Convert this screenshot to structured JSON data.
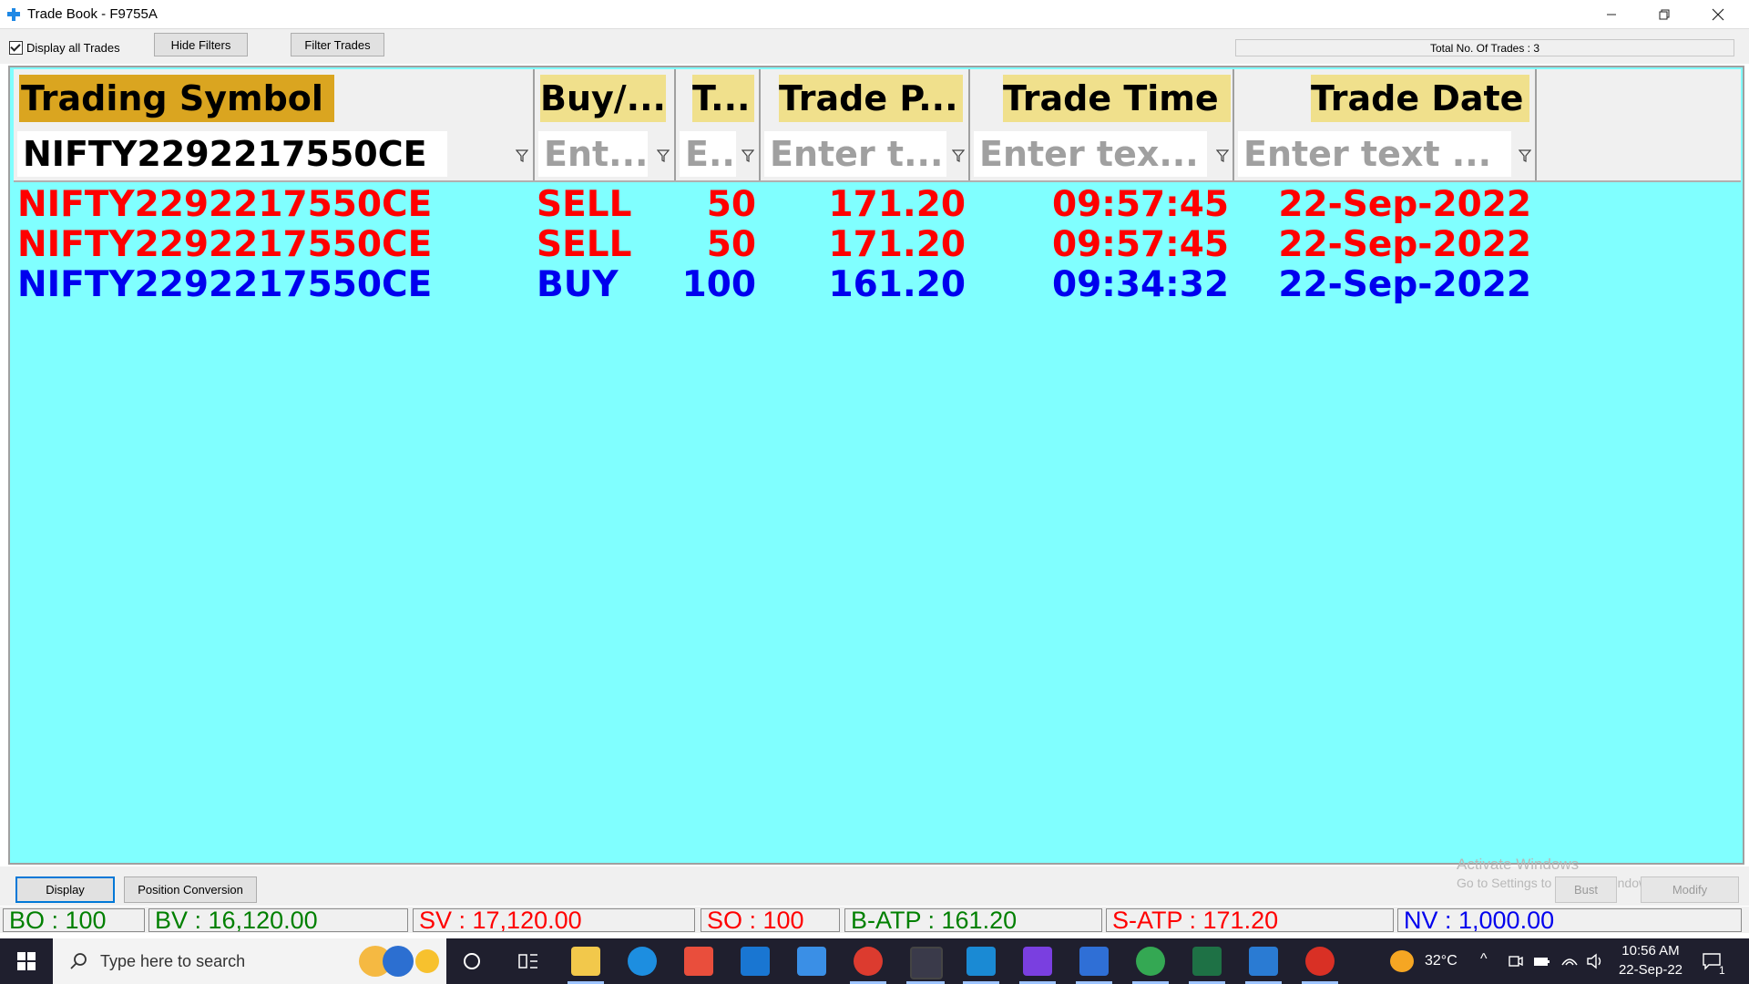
{
  "window": {
    "title": "Trade Book - F9755A",
    "minimize_icon": "minimize-icon",
    "restore_icon": "restore-icon",
    "close_icon": "close-icon"
  },
  "toolbar": {
    "display_all_label": "Display all Trades",
    "display_all_checked": true,
    "hide_filters_label": "Hide Filters",
    "filter_trades_label": "Filter Trades",
    "total_trades_text": "Total No. Of Trades : 3"
  },
  "grid": {
    "columns": [
      {
        "header": "Trading Symbol",
        "filter_value": "NIFTY2292217550CE",
        "filter_placeholder": ""
      },
      {
        "header": "Buy/...",
        "filter_value": "",
        "filter_placeholder": "Ent..."
      },
      {
        "header": "T...",
        "filter_value": "",
        "filter_placeholder": "E.."
      },
      {
        "header": "Trade P...",
        "filter_value": "",
        "filter_placeholder": "Enter t..."
      },
      {
        "header": "Trade Time",
        "filter_value": "",
        "filter_placeholder": "Enter tex..."
      },
      {
        "header": "Trade Date",
        "filter_value": "",
        "filter_placeholder": "Enter text ..."
      }
    ],
    "rows": [
      {
        "symbol": "NIFTY2292217550CE",
        "side": "SELL",
        "qty": "50",
        "price": "171.20",
        "time": "09:57:45",
        "date": "22-Sep-2022",
        "color": "#ff0000"
      },
      {
        "symbol": "NIFTY2292217550CE",
        "side": "SELL",
        "qty": "50",
        "price": "171.20",
        "time": "09:57:45",
        "date": "22-Sep-2022",
        "color": "#ff0000"
      },
      {
        "symbol": "NIFTY2292217550CE",
        "side": "BUY",
        "qty": "100",
        "price": "161.20",
        "time": "09:34:32",
        "date": "22-Sep-2022",
        "color": "#0000ee"
      }
    ],
    "header_highlight_color": "#f0e08c",
    "sorted_header_color": "#daa520",
    "background_color": "#80ffff"
  },
  "bottom": {
    "display_label": "Display",
    "position_conversion_label": "Position Conversion",
    "bust_label": "Bust",
    "modify_label": "Modify",
    "watermark_title": "Activate Windows",
    "watermark_sub": "Go to Settings to activate Windows."
  },
  "summary": {
    "bo": "BO : 100",
    "bv": "BV : 16,120.00",
    "sv": "SV : 17,120.00",
    "so": "SO : 100",
    "batp": "B-ATP : 161.20",
    "satp": "S-ATP : 171.20",
    "nv": "NV : 1,000.00"
  },
  "taskbar": {
    "search_placeholder": "Type here to search",
    "temperature": "32°C",
    "time": "10:56 AM",
    "date": "22-Sep-22",
    "notification_count": "1"
  }
}
